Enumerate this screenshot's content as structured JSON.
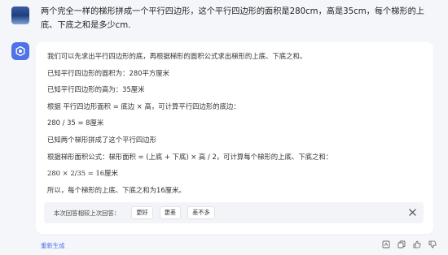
{
  "user_message": {
    "text": "两个完全一样的梯形拼成一个平行四边形，这个平行四边形的面积是280cm，高是35cm，每个梯形的上底、下底之和是多少cm."
  },
  "answer": {
    "lines": [
      "我们可以先求出平行四边形的底，再根据梯形的面积公式求出梯形的上底、下底之和。",
      "已知平行四边形的面积为：280平方厘米",
      "已知平行四边形的高为：35厘米",
      "根据 平行四边形面积 = 底边 × 高，可计算平行四边形的底边：",
      "280 / 35 = 8厘米",
      "已知两个梯形拼成了这个平行四边形",
      "根据梯形面积公式：梯形面积 = (上底 + 下底) × 高 / 2，可计算每个梯形的上底、下底之和：",
      "280 × 2/35 = 16厘米",
      "所以，每个梯形的上底、下底之和为16厘米。"
    ]
  },
  "feedback": {
    "prompt": "本次回答相较上次回答：",
    "options": [
      "更好",
      "更差",
      "差不多"
    ]
  },
  "footer": {
    "regenerate_label": "重新生成",
    "icons": [
      "export-icon",
      "copy-icon",
      "thumb-up-icon",
      "thumb-down-icon"
    ]
  },
  "colors": {
    "accent": "#4e72e8",
    "page_bg": "#f5f6fa",
    "card_bg": "#ffffff",
    "feedback_bg": "#f3f4f7"
  }
}
